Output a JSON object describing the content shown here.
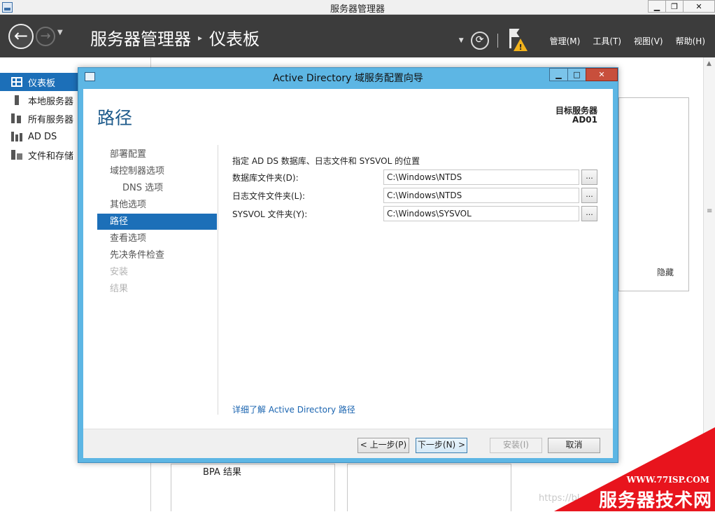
{
  "window": {
    "title": "服务器管理器",
    "buttons": [
      "▁",
      "❐",
      "✕"
    ]
  },
  "header": {
    "breadcrumb_root": "服务器管理器",
    "breadcrumb_sep": "▸",
    "breadcrumb_current": "仪表板",
    "menus": [
      "管理(M)",
      "工具(T)",
      "视图(V)",
      "帮助(H)"
    ]
  },
  "sidebar": {
    "items": [
      {
        "label": "仪表板",
        "icon": "dashboard-icon"
      },
      {
        "label": "本地服务器",
        "icon": "server-icon"
      },
      {
        "label": "所有服务器",
        "icon": "servers-icon"
      },
      {
        "label": "AD DS",
        "icon": "adds-icon"
      },
      {
        "label": "文件和存储",
        "icon": "file-storage-icon"
      }
    ]
  },
  "background": {
    "hide_label": "隐藏",
    "bpa_label": "BPA 结果",
    "faint_url": "https://bl"
  },
  "dialog": {
    "title": "Active Directory 域服务配置向导",
    "heading": "路径",
    "target_label": "目标服务器",
    "target_name": "AD01",
    "steps": [
      {
        "label": "部署配置",
        "state": "normal"
      },
      {
        "label": "域控制器选项",
        "state": "normal"
      },
      {
        "label": "DNS 选项",
        "state": "indent"
      },
      {
        "label": "其他选项",
        "state": "normal"
      },
      {
        "label": "路径",
        "state": "active"
      },
      {
        "label": "查看选项",
        "state": "normal"
      },
      {
        "label": "先决条件检查",
        "state": "normal"
      },
      {
        "label": "安装",
        "state": "disabled"
      },
      {
        "label": "结果",
        "state": "disabled"
      }
    ],
    "description": "指定 AD DS 数据库、日志文件和 SYSVOL 的位置",
    "fields": [
      {
        "label": "数据库文件夹(D):",
        "value": "C:\\Windows\\NTDS",
        "browse": "..."
      },
      {
        "label": "日志文件文件夹(L):",
        "value": "C:\\Windows\\NTDS",
        "browse": "..."
      },
      {
        "label": "SYSVOL 文件夹(Y):",
        "value": "C:\\Windows\\SYSVOL",
        "browse": "..."
      }
    ],
    "more_link": "详细了解 Active Directory 路径",
    "buttons": {
      "prev": "< 上一步(P)",
      "next": "下一步(N) >",
      "install": "安装(I)",
      "cancel": "取消"
    }
  },
  "watermark": {
    "url": "WWW.77ISP.COM",
    "text": "服务器技术网"
  },
  "colors": {
    "accent": "#1c6fb8",
    "header_bg": "#3c3c3c",
    "dialog_frame": "#5db6e4",
    "heading": "#1d5a8b",
    "watermark_red": "#e8141d"
  }
}
